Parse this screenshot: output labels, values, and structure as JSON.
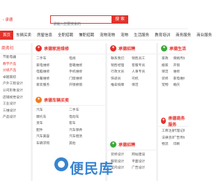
{
  "header": {
    "city_prefix": "- ",
    "city": "承德",
    "city_switch": "[切换]",
    "search_placeholder": "请输入您要搜索的",
    "search_button": "搜 索"
  },
  "nav": [
    "首页",
    "车辆买卖",
    "房屋信息",
    "全职招聘",
    "兼职招聘",
    "宠物宠物",
    "宠物",
    "生活服务",
    "教育培训",
    "商务服务",
    "商业服务"
  ],
  "left": {
    "title": "商务社",
    "items": [
      "节能电器",
      "教学产品",
      "分级产品",
      "卓越家纺",
      "户外工程设计",
      "公司形象设计",
      "店铺视觉设计",
      "工业设计",
      "三维设计",
      "产品设计"
    ],
    "items2": [
      "网站建设",
      "标志设计",
      "logo设计"
    ]
  },
  "panels": [
    {
      "title": "承德家居维修",
      "items": [
        "二手车",
        "电视",
        "家电维修",
        "音箱维修",
        "电脑维修",
        "手机维修",
        "水暖维修",
        "门窗维修",
        "家装服务",
        "开锁换锁"
      ]
    },
    {
      "title": "承德招聘",
      "items": [
        "联系我们",
        "销售员工",
        "销售经理",
        "客服专员",
        "行政文员",
        "人事专员",
        "快递员",
        "司机",
        "推拿按摩",
        "保洁"
      ]
    },
    {
      "title": "承德生活",
      "items": [
        "家政",
        "保姆月嫂",
        "搬家",
        "开锁",
        "保洁",
        "维修",
        "装修",
        "家电维修",
        "宠物",
        "婚庆"
      ]
    },
    {
      "title": "承德车辆买卖",
      "items": [
        "汽车",
        "二手车",
        "摩托车",
        "电动车",
        "货车",
        "客车",
        "配件",
        "汽车保养",
        "汽车美容",
        "汽车租赁",
        "车辆求购",
        "其他"
      ]
    },
    {
      "title": "承德招聘",
      "items": [
        "装修设计",
        "网站建设",
        "服装设计",
        "平面设计",
        "室内设计",
        "广告设计"
      ]
    },
    {
      "title": "承德商务服务",
      "items": [
        "工商注册",
        "代理记账",
        "法律咨询",
        "广告传媒",
        "物流",
        "印刷"
      ]
    }
  ],
  "watermark": "便民库"
}
